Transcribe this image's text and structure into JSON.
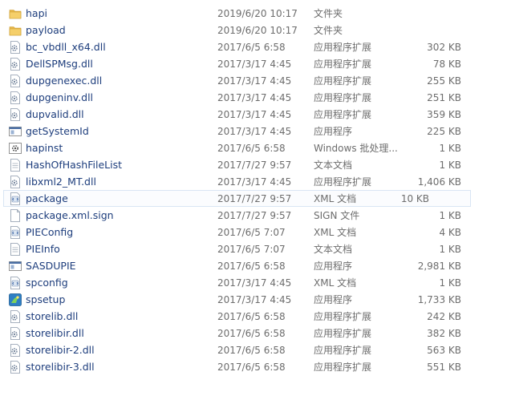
{
  "files": [
    {
      "name": "hapi",
      "date": "2019/6/20 10:17",
      "type": "文件夹",
      "size": "",
      "icon": "folder-icon"
    },
    {
      "name": "payload",
      "date": "2019/6/20 10:17",
      "type": "文件夹",
      "size": "",
      "icon": "folder-icon"
    },
    {
      "name": "bc_vbdll_x64.dll",
      "date": "2017/6/5 6:58",
      "type": "应用程序扩展",
      "size": "302 KB",
      "icon": "dll-icon"
    },
    {
      "name": "DellSPMsg.dll",
      "date": "2017/3/17 4:45",
      "type": "应用程序扩展",
      "size": "78 KB",
      "icon": "dll-icon"
    },
    {
      "name": "dupgenexec.dll",
      "date": "2017/3/17 4:45",
      "type": "应用程序扩展",
      "size": "255 KB",
      "icon": "dll-icon"
    },
    {
      "name": "dupgeninv.dll",
      "date": "2017/3/17 4:45",
      "type": "应用程序扩展",
      "size": "251 KB",
      "icon": "dll-icon"
    },
    {
      "name": "dupvalid.dll",
      "date": "2017/3/17 4:45",
      "type": "应用程序扩展",
      "size": "359 KB",
      "icon": "dll-icon"
    },
    {
      "name": "getSystemId",
      "date": "2017/3/17 4:45",
      "type": "应用程序",
      "size": "225 KB",
      "icon": "exe-icon"
    },
    {
      "name": "hapinst",
      "date": "2017/6/5 6:58",
      "type": "Windows 批处理...",
      "size": "1 KB",
      "icon": "batch-icon"
    },
    {
      "name": "HashOfHashFileList",
      "date": "2017/7/27 9:57",
      "type": "文本文档",
      "size": "1 KB",
      "icon": "text-file-icon"
    },
    {
      "name": "libxml2_MT.dll",
      "date": "2017/3/17 4:45",
      "type": "应用程序扩展",
      "size": "1,406 KB",
      "icon": "dll-icon"
    },
    {
      "name": "package",
      "date": "2017/7/27 9:57",
      "type": "XML 文档",
      "size": "10 KB",
      "icon": "xml-icon",
      "selected": true
    },
    {
      "name": "package.xml.sign",
      "date": "2017/7/27 9:57",
      "type": "SIGN 文件",
      "size": "1 KB",
      "icon": "blank-file-icon"
    },
    {
      "name": "PIEConfig",
      "date": "2017/6/5 7:07",
      "type": "XML 文档",
      "size": "4 KB",
      "icon": "xml-icon"
    },
    {
      "name": "PIEInfo",
      "date": "2017/6/5 7:07",
      "type": "文本文档",
      "size": "1 KB",
      "icon": "text-file-icon"
    },
    {
      "name": "SASDUPIE",
      "date": "2017/6/5 6:58",
      "type": "应用程序",
      "size": "2,981 KB",
      "icon": "exe-icon"
    },
    {
      "name": "spconfig",
      "date": "2017/3/17 4:45",
      "type": "XML 文档",
      "size": "1 KB",
      "icon": "xml-icon"
    },
    {
      "name": "spsetup",
      "date": "2017/3/17 4:45",
      "type": "应用程序",
      "size": "1,733 KB",
      "icon": "setup-icon"
    },
    {
      "name": "storelib.dll",
      "date": "2017/6/5 6:58",
      "type": "应用程序扩展",
      "size": "242 KB",
      "icon": "dll-icon"
    },
    {
      "name": "storelibir.dll",
      "date": "2017/6/5 6:58",
      "type": "应用程序扩展",
      "size": "382 KB",
      "icon": "dll-icon"
    },
    {
      "name": "storelibir-2.dll",
      "date": "2017/6/5 6:58",
      "type": "应用程序扩展",
      "size": "563 KB",
      "icon": "dll-icon"
    },
    {
      "name": "storelibir-3.dll",
      "date": "2017/6/5 6:58",
      "type": "应用程序扩展",
      "size": "551 KB",
      "icon": "dll-icon"
    }
  ]
}
